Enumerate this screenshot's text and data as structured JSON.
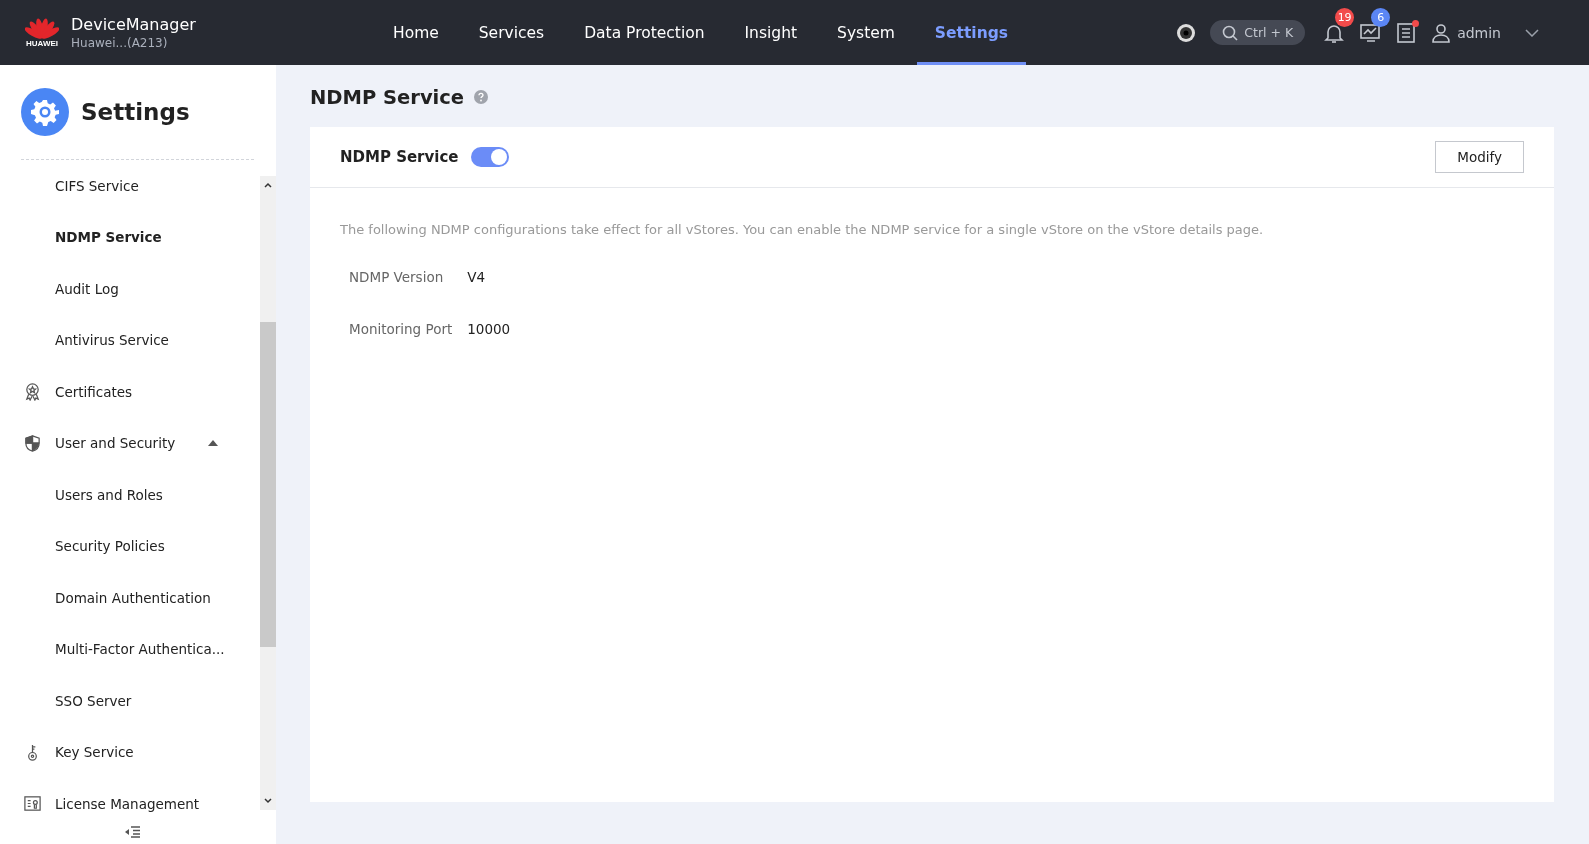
{
  "header": {
    "logo_text": "HUAWEI",
    "app_name": "DeviceManager",
    "device_name": "Huawei...(A213)"
  },
  "nav": [
    {
      "label": "Home",
      "selected": false
    },
    {
      "label": "Services",
      "selected": false
    },
    {
      "label": "Data Protection",
      "selected": false
    },
    {
      "label": "Insight",
      "selected": false
    },
    {
      "label": "System",
      "selected": false
    },
    {
      "label": "Settings",
      "selected": true
    }
  ],
  "toolbar": {
    "search_shortcut": "Ctrl + K",
    "alarm_count": "19",
    "task_count": "6",
    "message_unread": true,
    "user": "admin"
  },
  "sidebar": {
    "title": "Settings",
    "items": [
      {
        "kind": "sub",
        "label": "CIFS Service",
        "selected": false
      },
      {
        "kind": "sub",
        "label": "NDMP Service",
        "selected": true
      },
      {
        "kind": "sub",
        "label": "Audit Log",
        "selected": false
      },
      {
        "kind": "sub",
        "label": "Antivirus Service",
        "selected": false
      },
      {
        "kind": "group",
        "label": "Certificates",
        "selected": false
      },
      {
        "kind": "group",
        "label": "User and Security",
        "selected": false,
        "expanded": true,
        "children": [
          {
            "kind": "sub",
            "label": "Users and Roles",
            "selected": false
          },
          {
            "kind": "sub",
            "label": "Security Policies",
            "selected": false
          },
          {
            "kind": "sub",
            "label": "Domain Authentication",
            "selected": false
          },
          {
            "kind": "sub",
            "label": "Multi-Factor Authentica...",
            "selected": false
          },
          {
            "kind": "sub",
            "label": "SSO Server",
            "selected": false
          }
        ]
      },
      {
        "kind": "group",
        "label": "Key Service",
        "selected": false
      },
      {
        "kind": "group",
        "label": "License Management",
        "selected": false
      }
    ]
  },
  "page": {
    "title": "NDMP Service",
    "card": {
      "toggle_label": "NDMP Service",
      "toggle_on": true,
      "button": "Modify",
      "description": "The following NDMP configurations take effect for all vStores. You can enable the NDMP service for a single vStore on the vStore details page.",
      "fields": [
        {
          "label": "NDMP Version",
          "value": "V4"
        },
        {
          "label": "Monitoring Port",
          "value": "10000"
        }
      ]
    }
  }
}
